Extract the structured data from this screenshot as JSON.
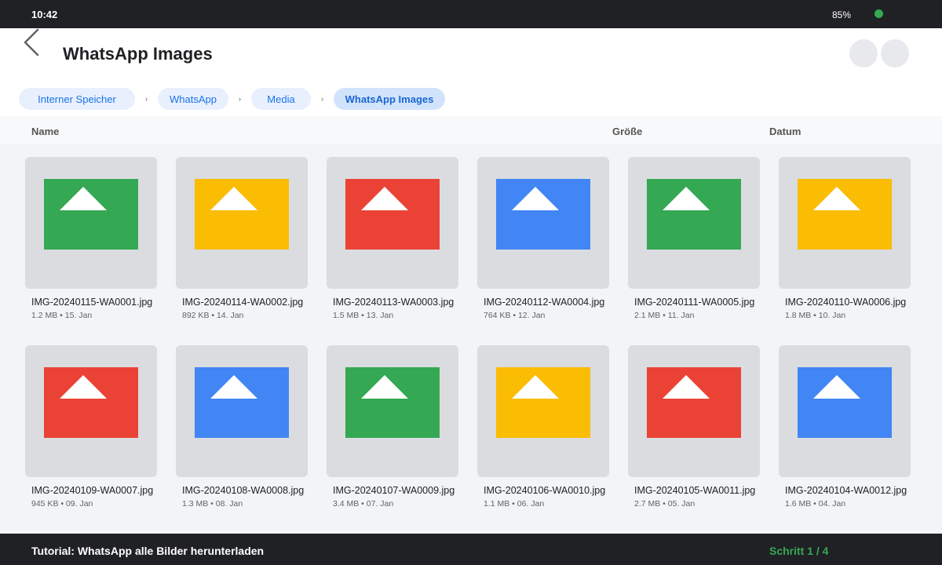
{
  "status_bar": {
    "time": "10:42",
    "battery": "85%",
    "dot_color": "#34a853"
  },
  "header": {
    "back_icon": "chevron-left-icon",
    "title": "WhatsApp Images"
  },
  "breadcrumb": {
    "items": [
      {
        "label": "Interner Speicher"
      },
      {
        "label": "WhatsApp"
      },
      {
        "label": "Media"
      },
      {
        "label": "WhatsApp Images"
      }
    ],
    "separator": "›"
  },
  "columns": {
    "name": "Name",
    "size": "Größe",
    "date": "Datum"
  },
  "files": [
    {
      "name": "IMG-20240115-WA0001.jpg",
      "meta": "1.2 MB • 15. Jan",
      "color": "#34a853"
    },
    {
      "name": "IMG-20240114-WA0002.jpg",
      "meta": "892 KB • 14. Jan",
      "color": "#fbbc04"
    },
    {
      "name": "IMG-20240113-WA0003.jpg",
      "meta": "1.5 MB • 13. Jan",
      "color": "#ea4335"
    },
    {
      "name": "IMG-20240112-WA0004.jpg",
      "meta": "764 KB • 12. Jan",
      "color": "#4285f4"
    },
    {
      "name": "IMG-20240111-WA0005.jpg",
      "meta": "2.1 MB • 11. Jan",
      "color": "#34a853"
    },
    {
      "name": "IMG-20240110-WA0006.jpg",
      "meta": "1.8 MB • 10. Jan",
      "color": "#fbbc04"
    },
    {
      "name": "IMG-20240109-WA0007.jpg",
      "meta": "945 KB • 09. Jan",
      "color": "#ea4335"
    },
    {
      "name": "IMG-20240108-WA0008.jpg",
      "meta": "1.3 MB • 08. Jan",
      "color": "#4285f4"
    },
    {
      "name": "IMG-20240107-WA0009.jpg",
      "meta": "3.4 MB • 07. Jan",
      "color": "#34a853"
    },
    {
      "name": "IMG-20240106-WA0010.jpg",
      "meta": "1.1 MB • 06. Jan",
      "color": "#fbbc04"
    },
    {
      "name": "IMG-20240105-WA0011.jpg",
      "meta": "2.7 MB • 05. Jan",
      "color": "#ea4335"
    },
    {
      "name": "IMG-20240104-WA0012.jpg",
      "meta": "1.6 MB • 04. Jan",
      "color": "#4285f4"
    }
  ],
  "footer": {
    "tutorial": "Tutorial: WhatsApp alle Bilder herunterladen",
    "step": "Schritt 1 / 4"
  }
}
